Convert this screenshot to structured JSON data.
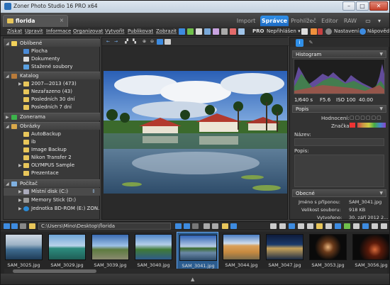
{
  "window": {
    "title": "Zoner Photo Studio 16 PRO x64",
    "min": "–",
    "max": "□",
    "close": "✕"
  },
  "doc_tab": {
    "label": "florida",
    "close": "×"
  },
  "modules": [
    "Import",
    "Správce",
    "Prohlížeč",
    "Editor",
    "RAW"
  ],
  "active_module": "Správce",
  "menu": [
    "Získat",
    "Upravit",
    "Informace",
    "Organizovat",
    "Vytvořit",
    "Publikovat",
    "Zobrazit"
  ],
  "menu_right": {
    "pro": "PRO",
    "share": "Nepřihlášen ▾",
    "settings": "Nastavení",
    "help": "Nápověda"
  },
  "nav": {
    "favorites_header": "Oblíbené",
    "favorites": [
      "Plocha",
      "Dokumenty",
      "Stažené soubory"
    ],
    "catalog_header": "Katalog",
    "catalog": [
      "2007—2013 (473)",
      "Nezařazeno (43)",
      "Posledních 30 dní",
      "Posledních 7 dní"
    ],
    "zonerama": "Zonerama",
    "pictures_header": "Obrázky",
    "pictures": [
      "AutoBackup",
      "ib",
      "Image Backup",
      "Nikon Transfer 2",
      "OLYMPUS Sample",
      "Prezentace"
    ],
    "computer_header": "Počítač",
    "computer": [
      "Místní disk (C:)",
      "Memory Stick (D:)",
      "Jednotka BD-ROM (E:) ZON..."
    ]
  },
  "right_panel": {
    "histogram_title": "Histogram",
    "exif": {
      "shutter": "1/640 s",
      "aperture": "F5.6",
      "iso": "ISO 100",
      "focal": "40.00"
    },
    "describe_title": "Popis",
    "rating_label": "Hodnocení:",
    "tag_label": "Značka:",
    "name_label": "Název:",
    "desc_label": "Popis:",
    "general_title": "Obecné",
    "filename_label": "Jméno s příponou:",
    "filename": "SAM_3041.jpg",
    "size_label": "Velikost souboru:",
    "size": "918 KB",
    "created_label": "Vytvořeno:",
    "created": "30. září 2012 2..."
  },
  "path": "C:\\Users\\Mino\\Desktop\\florida",
  "thumbnails": [
    "SAM_3025.jpg",
    "SAM_3029.jpg",
    "SAM_3039.jpg",
    "SAM_3040.jpg",
    "SAM_3041.jpg",
    "SAM_3044.jpg",
    "SAM_3047.jpg",
    "SAM_3053.jpg",
    "SAM_3056.jpg"
  ],
  "selected_thumbnail": "SAM_3041.jpg",
  "colors": {
    "accent": "#1f6bc3",
    "panel": "#393939",
    "selection": "#2b5c8f"
  }
}
